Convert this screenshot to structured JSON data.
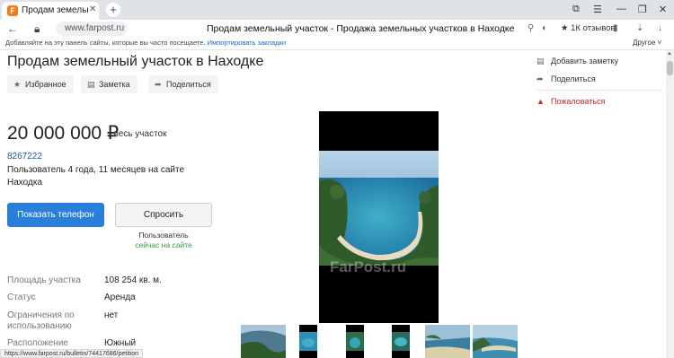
{
  "browser": {
    "tab_title": "Продам земельный уч",
    "tab_favicon": "F",
    "url": "www.farpost.ru",
    "page_title": "Продам земельный участок - Продажа земельных участков в Находке",
    "reviews_label": "★ 1К отзывов",
    "bookmarks_text": "Добавляйте на эту панель сайты, которые вы часто посещаете.",
    "bookmarks_import": "Импортировать закладки",
    "bookmarks_other": "Другое",
    "status_url": "https://www.farpost.ru/bulletin/74417686/petition"
  },
  "listing": {
    "title": "Продам земельный участок в Находке",
    "actions": {
      "favorite": "Избранное",
      "note": "Заметка",
      "share": "Поделиться"
    },
    "price": "20 000 000 ₽",
    "price_suffix": "/ весь участок",
    "ad_id": "8267222",
    "user_since": "Пользователь 4 года, 11 месяцев на сайте",
    "city": "Находка",
    "buttons": {
      "show_phone": "Показать телефон",
      "ask": "Спросить"
    },
    "online_user": "Пользователь",
    "online_status": "сейчас на сайте",
    "properties": [
      {
        "label": "Площадь участка",
        "value": "108 254 кв. м."
      },
      {
        "label": "Статус",
        "value": "Аренда"
      },
      {
        "label": "Ограничения по использованию",
        "value": "нет"
      },
      {
        "label": "Расположение",
        "value": "Южный"
      }
    ],
    "watermark": "FarPost.ru"
  },
  "sidebar": {
    "add_note": "Добавить заметку",
    "share": "Поделиться",
    "report": "Пожаловаться"
  },
  "colors": {
    "accent": "#2a7fdb",
    "online": "#3a9a3a",
    "report": "#c62828"
  }
}
